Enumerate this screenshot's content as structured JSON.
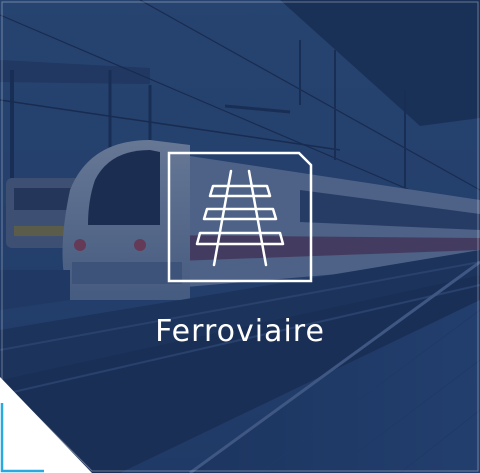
{
  "tile": {
    "label": "Ferroviaire",
    "icon": "railway-track-icon",
    "accent_color": "#29a9e0",
    "overlay_color": "#182e56"
  }
}
